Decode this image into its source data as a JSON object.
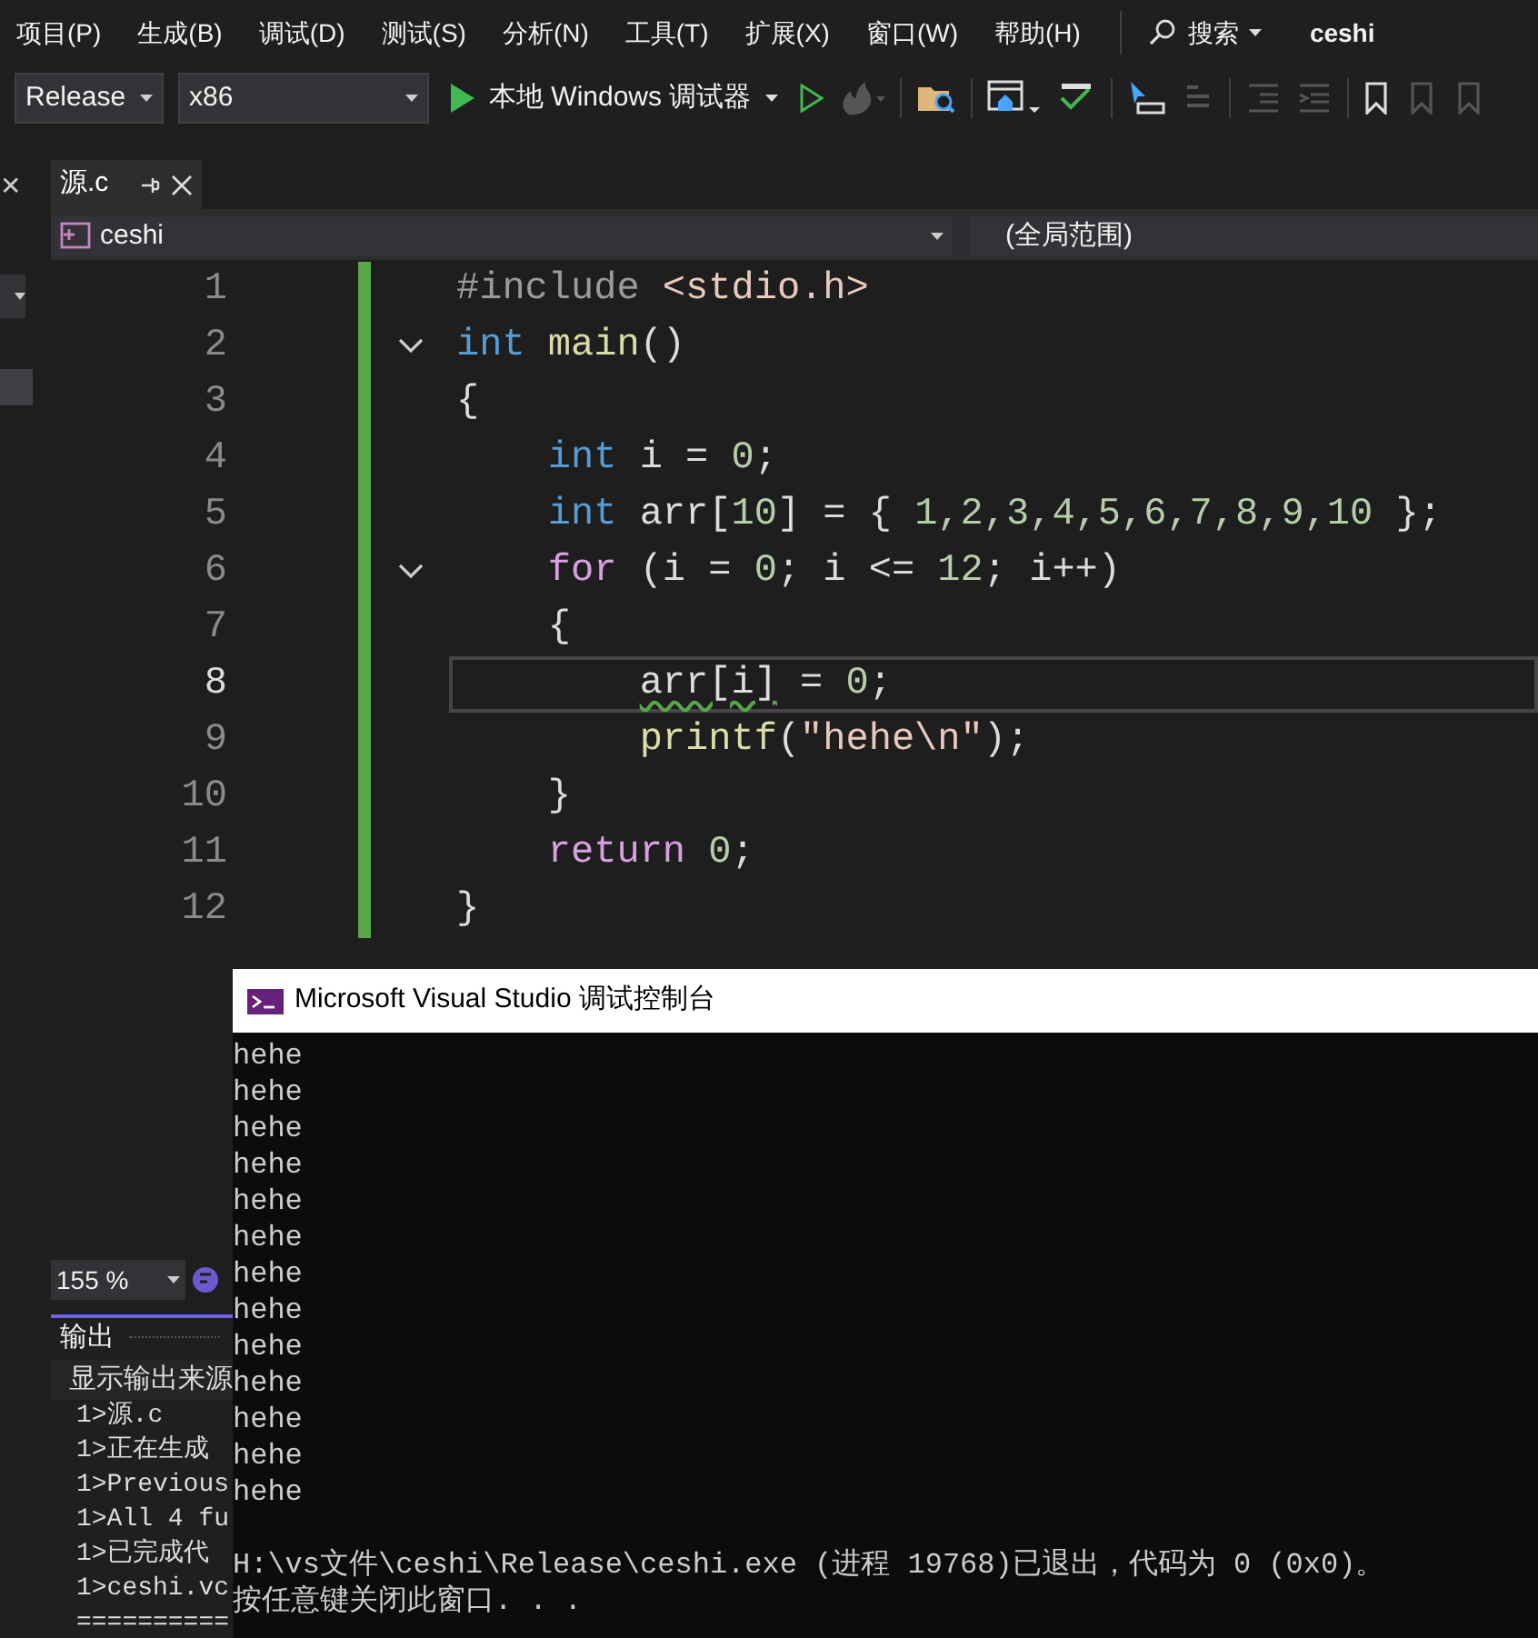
{
  "menu": [
    "项目(P)",
    "生成(B)",
    "调试(D)",
    "测试(S)",
    "分析(N)",
    "工具(T)",
    "扩展(X)",
    "窗口(W)",
    "帮助(H)"
  ],
  "search": {
    "label": "搜索"
  },
  "solution_name": "ceshi",
  "toolbar": {
    "configuration": "Release",
    "platform": "x86",
    "debugger": "本地 Windows 调试器"
  },
  "left_panel": {
    "close_glyph": "✕"
  },
  "tabs": [
    {
      "label": "源.c",
      "selected": true
    }
  ],
  "navigation": {
    "project": "ceshi",
    "scope": "(全局范围)"
  },
  "code_lines": [
    {
      "number": "1",
      "current": false,
      "foldable": false,
      "squiggle": false,
      "tokens": [
        {
          "kind": "pre",
          "text": "#include"
        },
        {
          "kind": "inc",
          "text": " <stdio.h>"
        }
      ]
    },
    {
      "number": "2",
      "current": false,
      "foldable": true,
      "squiggle": false,
      "tokens": [
        {
          "kind": "kw",
          "text": "int"
        },
        {
          "kind": "fn",
          "text": " main"
        },
        {
          "kind": "p",
          "text": "()"
        }
      ]
    },
    {
      "number": "3",
      "current": false,
      "foldable": false,
      "squiggle": false,
      "tokens": [
        {
          "kind": "p",
          "text": "{"
        }
      ]
    },
    {
      "number": "4",
      "current": false,
      "foldable": false,
      "squiggle": false,
      "tokens": [
        {
          "kind": "kw",
          "text": "    int"
        },
        {
          "kind": "p",
          "text": " i = "
        },
        {
          "kind": "num",
          "text": "0"
        },
        {
          "kind": "p",
          "text": ";"
        }
      ]
    },
    {
      "number": "5",
      "current": false,
      "foldable": false,
      "squiggle": false,
      "tokens": [
        {
          "kind": "kw",
          "text": "    int"
        },
        {
          "kind": "p",
          "text": " arr["
        },
        {
          "kind": "num",
          "text": "10"
        },
        {
          "kind": "p",
          "text": "] = { "
        },
        {
          "kind": "num",
          "text": "1,2,3,4,5,6,7,8,9,10"
        },
        {
          "kind": "p",
          "text": " };"
        }
      ]
    },
    {
      "number": "6",
      "current": false,
      "foldable": true,
      "squiggle": false,
      "tokens": [
        {
          "kind": "ctl",
          "text": "    for"
        },
        {
          "kind": "p",
          "text": " (i = "
        },
        {
          "kind": "num",
          "text": "0"
        },
        {
          "kind": "p",
          "text": "; i <= "
        },
        {
          "kind": "num",
          "text": "12"
        },
        {
          "kind": "p",
          "text": "; i++)"
        }
      ]
    },
    {
      "number": "7",
      "current": false,
      "foldable": false,
      "squiggle": false,
      "tokens": [
        {
          "kind": "p",
          "text": "    {"
        }
      ]
    },
    {
      "number": "8",
      "current": true,
      "foldable": false,
      "squiggle": true,
      "tokens": [
        {
          "kind": "id",
          "text": "        arr[i]"
        },
        {
          "kind": "p",
          "text": " = "
        },
        {
          "kind": "num",
          "text": "0"
        },
        {
          "kind": "p",
          "text": ";"
        }
      ]
    },
    {
      "number": "9",
      "current": false,
      "foldable": false,
      "squiggle": false,
      "tokens": [
        {
          "kind": "fn",
          "text": "        printf"
        },
        {
          "kind": "p",
          "text": "("
        },
        {
          "kind": "str",
          "text": "\"hehe\\n\""
        },
        {
          "kind": "p",
          "text": ");"
        }
      ]
    },
    {
      "number": "10",
      "current": false,
      "foldable": false,
      "squiggle": false,
      "tokens": [
        {
          "kind": "p",
          "text": "    }"
        }
      ]
    },
    {
      "number": "11",
      "current": false,
      "foldable": false,
      "squiggle": false,
      "tokens": [
        {
          "kind": "ctl",
          "text": "    return"
        },
        {
          "kind": "num",
          "text": " 0"
        },
        {
          "kind": "p",
          "text": ";"
        }
      ]
    },
    {
      "number": "12",
      "current": false,
      "foldable": false,
      "squiggle": false,
      "tokens": [
        {
          "kind": "p",
          "text": "}"
        }
      ]
    }
  ],
  "zoom": "155 %",
  "output": {
    "title": "输出",
    "source_label": "显示输出来源",
    "lines": [
      "1>源.c",
      "1>正在生成",
      "1>Previous",
      "1>All 4 fu",
      "1>已完成代",
      "1>ceshi.vc",
      "=========="
    ]
  },
  "console": {
    "title": "Microsoft Visual Studio 调试控制台",
    "program_lines": [
      "hehe",
      "hehe",
      "hehe",
      "hehe",
      "hehe",
      "hehe",
      "hehe",
      "hehe",
      "hehe",
      "hehe",
      "hehe",
      "hehe",
      "hehe"
    ],
    "exit_lines": [
      "H:\\vs文件\\ceshi\\Release\\ceshi.exe (进程 19768)已退出，代码为 0 (0x0)。",
      "按任意键关闭此窗口. . ."
    ]
  }
}
